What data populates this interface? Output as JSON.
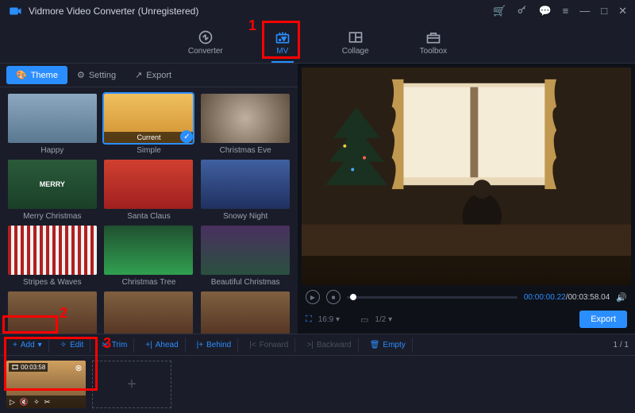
{
  "app": {
    "title": "Vidmore Video Converter (Unregistered)"
  },
  "topnav": {
    "converter": "Converter",
    "mv": "MV",
    "collage": "Collage",
    "toolbox": "Toolbox"
  },
  "subtabs": {
    "theme": "Theme",
    "setting": "Setting",
    "export": "Export"
  },
  "themes": [
    {
      "label": "Happy"
    },
    {
      "label": "Simple",
      "badge": "Current"
    },
    {
      "label": "Christmas Eve"
    },
    {
      "label": "Merry Christmas"
    },
    {
      "label": "Santa Claus"
    },
    {
      "label": "Snowy Night"
    },
    {
      "label": "Stripes & Waves"
    },
    {
      "label": "Christmas Tree"
    },
    {
      "label": "Beautiful Christmas"
    }
  ],
  "player": {
    "time_current": "00:00:00.22",
    "time_total": "00:03:58.04",
    "aspect": "16:9",
    "page": "1/2"
  },
  "export_btn": "Export",
  "toolbar": {
    "add": "Add",
    "edit": "Edit",
    "trim": "Trim",
    "ahead": "Ahead",
    "behind": "Behind",
    "forward": "Forward",
    "backward": "Backward",
    "empty": "Empty",
    "pages": "1 / 1"
  },
  "clip": {
    "duration": "00:03:58"
  },
  "annotations": {
    "a1": "1",
    "a2": "2",
    "a3": "3"
  },
  "merry_text": "MERRY"
}
